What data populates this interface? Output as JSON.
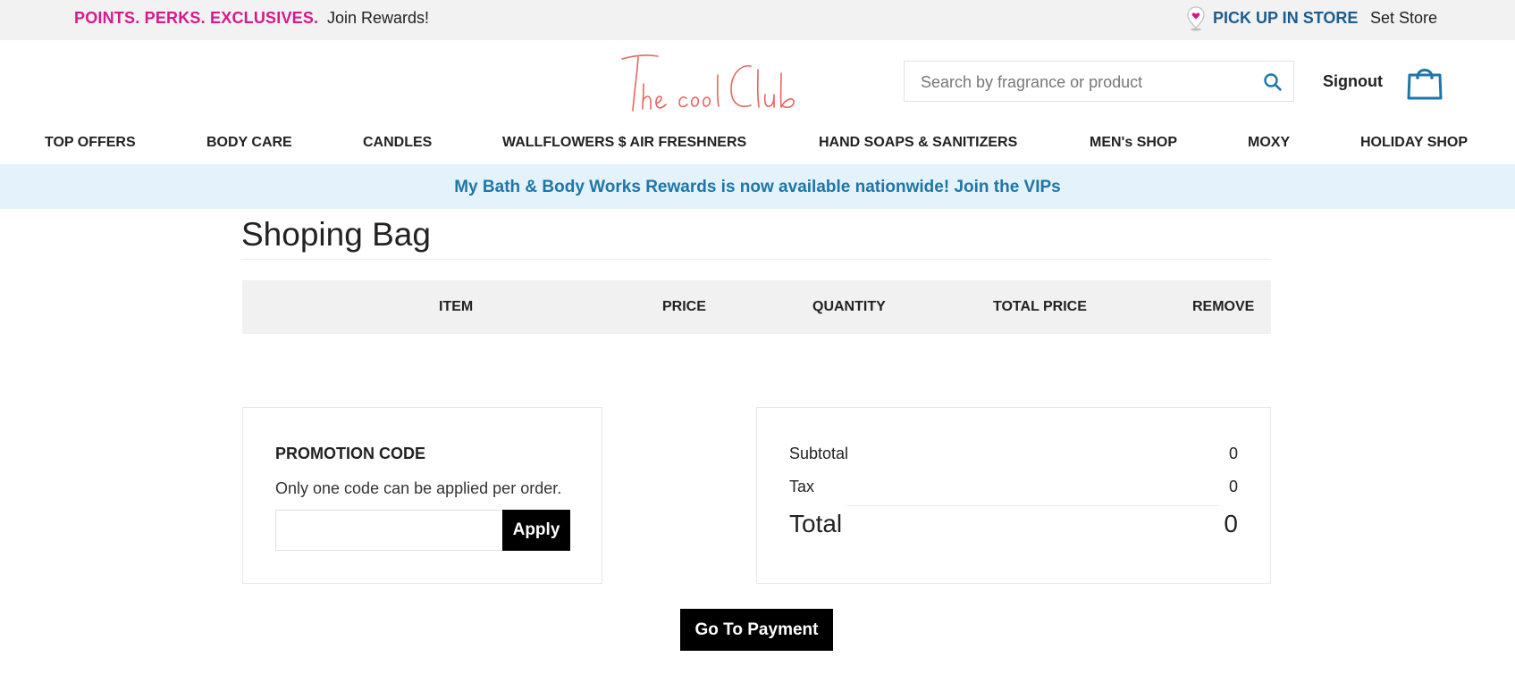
{
  "topbar": {
    "perks_text": "POINTS. PERKS. EXCLUSIVES.",
    "join_link": "Join Rewards!",
    "pickup_text": "PICK UP IN STORE",
    "set_store_link": "Set Store",
    "perks_color": "#d6198d",
    "pickup_color": "#1c5d8f"
  },
  "header": {
    "logo_text": "The cool Club",
    "search_placeholder": "Search by fragrance or product",
    "search_icon": "search-icon",
    "signout_label": "Signout",
    "bag_icon": "shopping-bag-icon"
  },
  "nav": {
    "items": [
      {
        "label": "TOP OFFERS"
      },
      {
        "label": "BODY CARE"
      },
      {
        "label": "CANDLES"
      },
      {
        "label": "WALLFLOWERS $ AIR FRESHNERS"
      },
      {
        "label": "HAND SOAPS & SANITIZERS"
      },
      {
        "label": "MEN's SHOP"
      },
      {
        "label": "MOXY"
      },
      {
        "label": "HOLIDAY SHOP"
      }
    ]
  },
  "banner": {
    "text": "My Bath & Body Works Rewards is now available nationwide! Join the VIPs",
    "background": "#e3f2fb",
    "color": "#1e76a8"
  },
  "cart": {
    "title": "Shoping Bag",
    "columns": [
      "ITEM",
      "PRICE",
      "QUANTITY",
      "TOTAL PRICE",
      "REMOVE"
    ],
    "rows": []
  },
  "promo": {
    "title": "PROMOTION CODE",
    "note": "Only one code can be applied per order.",
    "input_value": "",
    "apply_label": "Apply"
  },
  "summary": {
    "subtotal_label": "Subtotal",
    "subtotal_value": "0",
    "tax_label": "Tax",
    "tax_value": "0",
    "total_label": "Total",
    "total_value": "0"
  },
  "checkout": {
    "payment_label": "Go To Payment"
  }
}
